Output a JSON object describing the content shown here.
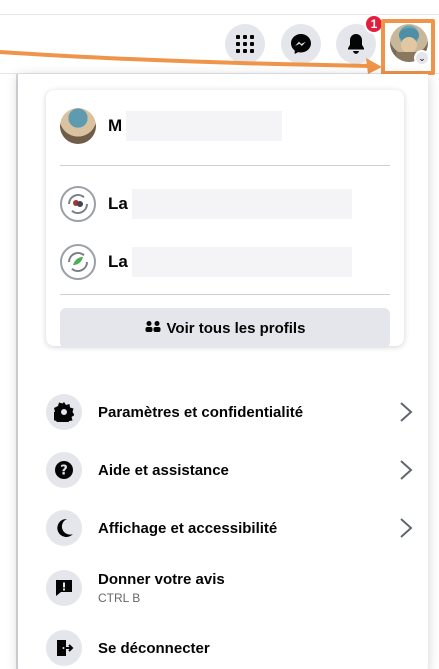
{
  "header": {
    "notification_count": "1",
    "icons": [
      "apps-grid-icon",
      "messenger-icon",
      "bell-icon",
      "account-avatar",
      "chevron-down-icon"
    ]
  },
  "colors": {
    "accent_orange": "#f0944a",
    "badge_red": "#e41e3f",
    "icon_bg": "#e4e6eb"
  },
  "profiles": [
    {
      "name": "M",
      "avatar": "user-avatar"
    },
    {
      "name": "La",
      "avatar": "page-avatar"
    },
    {
      "name": "La",
      "avatar": "page-avatar"
    }
  ],
  "see_all": {
    "label": "Voir tous les profils",
    "icon": "profiles-swap-icon"
  },
  "menu": [
    {
      "label": "Paramètres et confidentialité",
      "icon": "gear-icon",
      "has_chevron": true
    },
    {
      "label": "Aide et assistance",
      "icon": "question-icon",
      "has_chevron": true
    },
    {
      "label": "Affichage et accessibilité",
      "icon": "moon-icon",
      "has_chevron": true
    },
    {
      "label": "Donner votre avis",
      "sub": "CTRL B",
      "icon": "feedback-icon",
      "has_chevron": false
    },
    {
      "label": "Se déconnecter",
      "icon": "logout-icon",
      "has_chevron": false
    }
  ]
}
